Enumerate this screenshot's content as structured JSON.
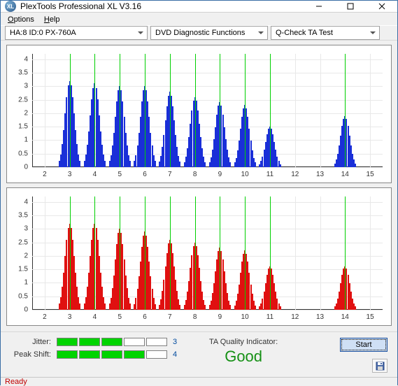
{
  "window": {
    "title": "PlexTools Professional XL V3.16"
  },
  "menu": {
    "options": "Options",
    "help": "Help"
  },
  "toolbar": {
    "drive": "HA:8 ID:0   PX-760A",
    "category": "DVD Diagnostic Functions",
    "test": "Q-Check TA Test"
  },
  "chart_data": [
    {
      "type": "bar",
      "color": "#1a2fd8",
      "xlim": [
        1.5,
        15.5
      ],
      "ylim": [
        0,
        4.2
      ],
      "yticks": [
        0,
        0.5,
        1,
        1.5,
        2,
        2.5,
        3,
        3.5,
        4
      ],
      "xticks": [
        2,
        3,
        4,
        5,
        6,
        7,
        8,
        9,
        10,
        11,
        12,
        13,
        14,
        15
      ],
      "markers": [
        3,
        4,
        5,
        6,
        7,
        8,
        9,
        10,
        11,
        14
      ],
      "clusters": [
        {
          "c": 3,
          "h": 3.2
        },
        {
          "c": 4,
          "h": 3.1
        },
        {
          "c": 5,
          "h": 3.0
        },
        {
          "c": 6,
          "h": 3.0
        },
        {
          "c": 7,
          "h": 2.8
        },
        {
          "c": 8,
          "h": 2.6
        },
        {
          "c": 9,
          "h": 2.4
        },
        {
          "c": 10,
          "h": 2.3
        },
        {
          "c": 11,
          "h": 1.5
        },
        {
          "c": 14,
          "h": 1.9
        }
      ]
    },
    {
      "type": "bar",
      "color": "#e01010",
      "xlim": [
        1.5,
        15.5
      ],
      "ylim": [
        0,
        4.2
      ],
      "yticks": [
        0,
        0.5,
        1,
        1.5,
        2,
        2.5,
        3,
        3.5,
        4
      ],
      "xticks": [
        2,
        3,
        4,
        5,
        6,
        7,
        8,
        9,
        10,
        11,
        12,
        13,
        14,
        15
      ],
      "markers": [
        3,
        4,
        5,
        6,
        7,
        8,
        9,
        10,
        11,
        14
      ],
      "clusters": [
        {
          "c": 3,
          "h": 3.2
        },
        {
          "c": 4,
          "h": 3.2
        },
        {
          "c": 5,
          "h": 3.0
        },
        {
          "c": 6,
          "h": 2.9
        },
        {
          "c": 7,
          "h": 2.6
        },
        {
          "c": 8,
          "h": 2.5
        },
        {
          "c": 9,
          "h": 2.3
        },
        {
          "c": 10,
          "h": 2.2
        },
        {
          "c": 11,
          "h": 1.6
        },
        {
          "c": 14,
          "h": 1.6
        }
      ]
    }
  ],
  "meters": {
    "jitter": {
      "label": "Jitter:",
      "value": 3,
      "max": 5
    },
    "peak": {
      "label": "Peak Shift:",
      "value": 4,
      "max": 5
    }
  },
  "taq": {
    "label": "TA Quality Indicator:",
    "value": "Good"
  },
  "actions": {
    "start": "Start"
  },
  "status": {
    "text": "Ready"
  }
}
